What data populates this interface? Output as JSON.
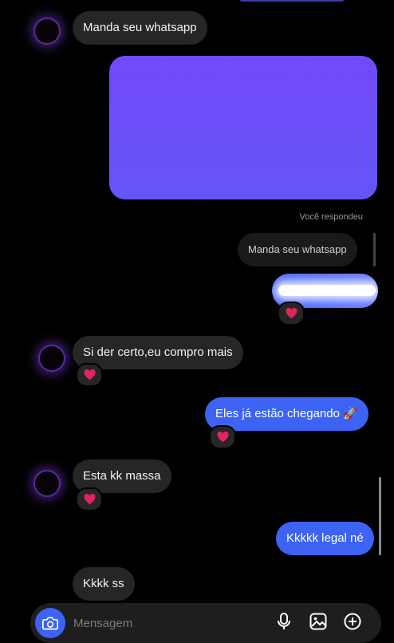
{
  "thread": {
    "msg1": "Manda seu whatsapp",
    "reply_caption": "Você respondeu",
    "reply_quote": "Manda seu whatsapp",
    "msg_in_2": "Si der certo,eu compro mais",
    "msg_out_1": "Eles já estão chegando 🚀",
    "msg_in_3": "Esta kk massa",
    "msg_out_2": "Kkkkk legal né",
    "msg_in_4": "Kkkk ss"
  },
  "reaction_emoji": "red-heart",
  "composer": {
    "placeholder": "Mensagem"
  },
  "colors": {
    "background": "#000000",
    "incoming_bubble": "#262626",
    "outgoing_bubble": "#3d63f5",
    "media_card": "#6c4ff8",
    "heart": "#e0245e"
  },
  "icons": [
    "camera-icon",
    "microphone-icon",
    "gallery-icon",
    "sticker-icon",
    "heart-icon"
  ]
}
